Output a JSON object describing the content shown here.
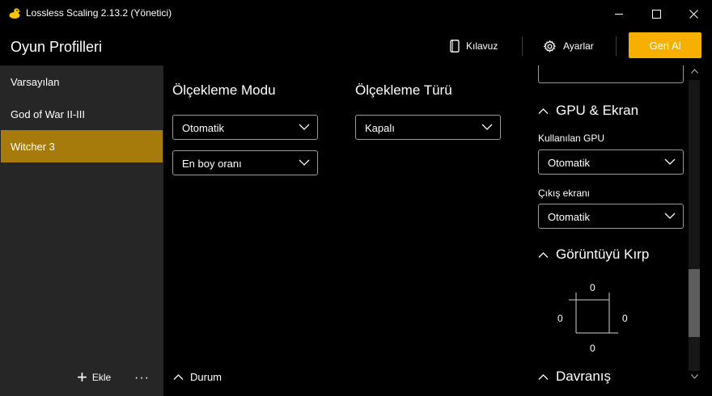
{
  "window": {
    "title": "Lossless Scaling 2.13.2 (Yönetici)",
    "app_icon": "duck-icon",
    "accent_color": "#f7b000",
    "selected_color": "#a67a0b"
  },
  "header": {
    "title": "Oyun Profilleri",
    "guide_label": "Kılavuz",
    "settings_label": "Ayarlar",
    "revert_label": "Geri Al"
  },
  "sidebar": {
    "profiles": [
      {
        "label": "Varsayılan",
        "selected": false
      },
      {
        "label": "God of War II-III",
        "selected": false
      },
      {
        "label": "Witcher 3",
        "selected": true
      }
    ],
    "add_label": "Ekle",
    "more_label": "···"
  },
  "main": {
    "scaling_mode": {
      "heading": "Ölçekleme Modu",
      "mode_value": "Otomatik",
      "aspect_value": "En boy oranı"
    },
    "scaling_type": {
      "heading": "Ölçekleme Türü",
      "value": "Kapalı"
    },
    "status_label": "Durum"
  },
  "right_panel": {
    "gpu_section": {
      "heading": "GPU & Ekran",
      "gpu_label": "Kullanılan GPU",
      "gpu_value": "Otomatik",
      "output_label": "Çıkış ekranı",
      "output_value": "Otomatik"
    },
    "crop_section": {
      "heading": "Görüntüyü Kırp",
      "top": "0",
      "left": "0",
      "right": "0",
      "bottom": "0"
    },
    "behavior_section": {
      "heading": "Davranış"
    }
  }
}
